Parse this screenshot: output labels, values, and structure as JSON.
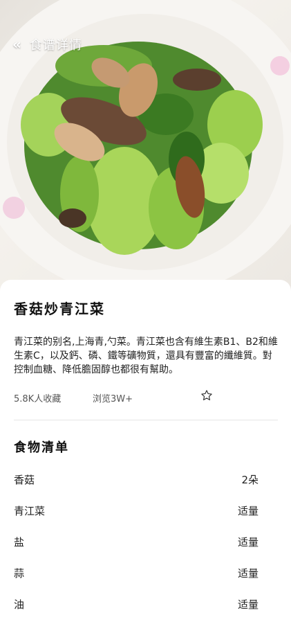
{
  "header": {
    "back_icon": "chevron-double-left-icon",
    "title": "食谱详情"
  },
  "recipe": {
    "title": "香菇炒青江菜",
    "description": "青江菜的别名,上海青,勺菜。青江菜也含有維生素B1、B2和維生素C，以及鈣、磷、鐵等礦物質，還具有豐富的纖維質。對控制血糖、降低膽固醇也都很有幫助。",
    "favorites": "5.8K人收藏",
    "views": "浏览3W+",
    "favorite_icon": "star-outline-icon"
  },
  "food_list": {
    "title": "食物清单",
    "items": [
      {
        "name": "香菇",
        "amount": "2朵"
      },
      {
        "name": "青江菜",
        "amount": "适量"
      },
      {
        "name": "盐",
        "amount": "适量"
      },
      {
        "name": "蒜",
        "amount": "适量"
      },
      {
        "name": "油",
        "amount": "适量"
      }
    ]
  },
  "colors": {
    "card_background": "#ffffff",
    "divider": "#e6e6e6",
    "text_primary": "#111111",
    "text_secondary": "#555555"
  }
}
